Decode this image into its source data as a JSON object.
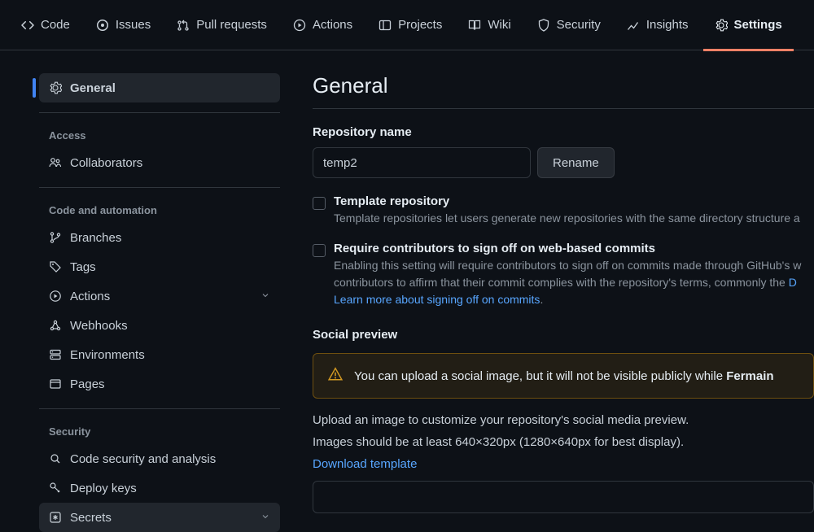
{
  "topnav": {
    "items": [
      {
        "label": "Code"
      },
      {
        "label": "Issues"
      },
      {
        "label": "Pull requests"
      },
      {
        "label": "Actions"
      },
      {
        "label": "Projects"
      },
      {
        "label": "Wiki"
      },
      {
        "label": "Security"
      },
      {
        "label": "Insights"
      },
      {
        "label": "Settings"
      }
    ]
  },
  "sidebar": {
    "general": "General",
    "group_access": "Access",
    "collaborators": "Collaborators",
    "group_code": "Code and automation",
    "branches": "Branches",
    "tags": "Tags",
    "actions": "Actions",
    "webhooks": "Webhooks",
    "environments": "Environments",
    "pages": "Pages",
    "group_security": "Security",
    "code_security": "Code security and analysis",
    "deploy_keys": "Deploy keys",
    "secrets": "Secrets"
  },
  "main": {
    "title": "General",
    "repo_name_label": "Repository name",
    "repo_name_value": "temp2",
    "rename_btn": "Rename",
    "template_title": "Template repository",
    "template_desc": "Template repositories let users generate new repositories with the same directory structure a",
    "signoff_title": "Require contributors to sign off on web-based commits",
    "signoff_desc": "Enabling this setting will require contributors to sign off on commits made through GitHub's w contributors to affirm that their commit complies with the repository's terms, commonly the ",
    "signoff_link": "Learn more about signing off on commits",
    "social_title": "Social preview",
    "social_warn_prefix": "You can upload a social image, but it will not be visible publicly while ",
    "social_warn_bold": "Fermain",
    "social_desc1": "Upload an image to customize your repository's social media preview.",
    "social_desc2": "Images should be at least 640×320px (1280×640px for best display).",
    "download_template": "Download template"
  }
}
